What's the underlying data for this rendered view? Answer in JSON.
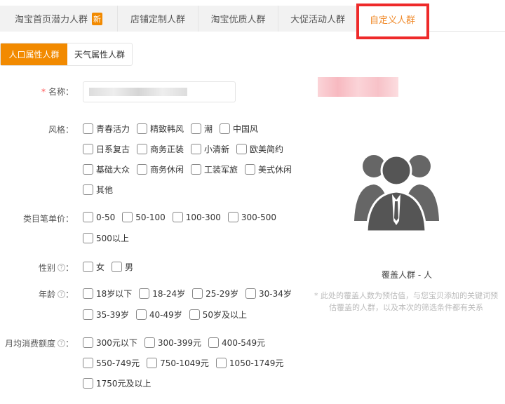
{
  "tabs": [
    {
      "label": "淘宝首页潜力人群",
      "badge": "新"
    },
    {
      "label": "店铺定制人群"
    },
    {
      "label": "淘宝优质人群"
    },
    {
      "label": "大促活动人群"
    },
    {
      "label": "自定义人群"
    }
  ],
  "subtabs": [
    "人口属性人群",
    "天气属性人群"
  ],
  "form": {
    "name_label": "名称：",
    "name_required": "*",
    "style_label": "风格：",
    "style_options": [
      [
        "青春活力",
        "精致韩风",
        "潮",
        "中国风"
      ],
      [
        "日系复古",
        "商务正装",
        "小清新",
        "欧美简约"
      ],
      [
        "基础大众",
        "商务休闲",
        "工装军旅",
        "美式休闲"
      ],
      [
        "其他"
      ]
    ],
    "price_label": "类目笔单价：",
    "price_options": [
      [
        "0-50",
        "50-100",
        "100-300",
        "300-500"
      ],
      [
        "500以上"
      ]
    ],
    "gender_label": "性别",
    "gender_options": [
      [
        "女",
        "男"
      ]
    ],
    "age_label": "年龄",
    "age_options": [
      [
        "18岁以下",
        "18-24岁",
        "25-29岁",
        "30-34岁"
      ],
      [
        "35-39岁",
        "40-49岁",
        "50岁及以上"
      ]
    ],
    "spend_label": "月均消费额度",
    "spend_options": [
      [
        "300元以下",
        "300-399元",
        "400-549元"
      ],
      [
        "550-749元",
        "750-1049元",
        "1050-1749元"
      ],
      [
        "1750元及以上"
      ]
    ],
    "help_glyph": "?",
    "colon": "："
  },
  "side": {
    "cover_text": "覆盖人群 - 人",
    "note": "* 此处的覆盖人数为预估值，与您宝贝添加的关键词预估覆盖的人群，以及本次的筛选条件都有关系"
  },
  "colors": {
    "accent": "#f28a00",
    "highlight": "#ee2a2a"
  }
}
